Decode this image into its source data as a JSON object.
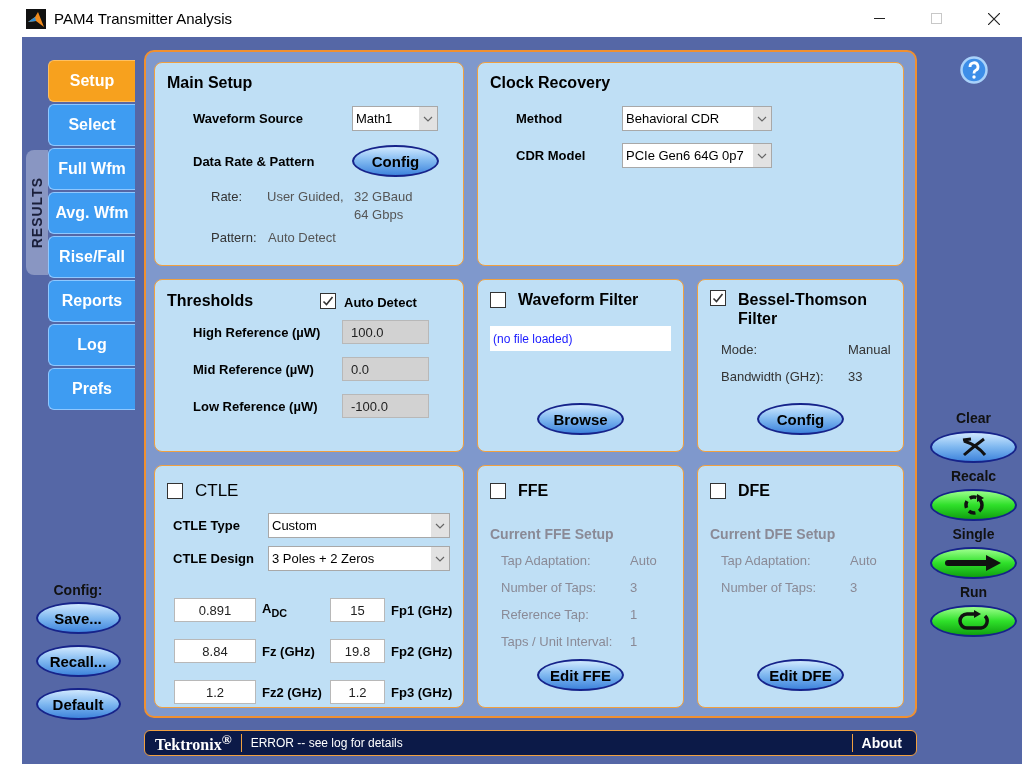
{
  "window": {
    "title": "PAM4 Transmitter Analysis",
    "maximize_disabled": true
  },
  "tabs": [
    {
      "label": "Setup",
      "selected": true
    },
    {
      "label": "Select",
      "selected": false
    },
    {
      "label": "Full Wfm",
      "selected": false
    },
    {
      "label": "Avg. Wfm",
      "selected": false
    },
    {
      "label": "Rise/Fall",
      "selected": false
    },
    {
      "label": "Reports",
      "selected": false
    },
    {
      "label": "Log",
      "selected": false
    },
    {
      "label": "Prefs",
      "selected": false
    }
  ],
  "results_label": "RESULTS",
  "config": {
    "label": "Config:",
    "buttons": [
      "Save...",
      "Recall...",
      "Default"
    ]
  },
  "main_setup": {
    "title": "Main Setup",
    "waveform_source": {
      "label": "Waveform Source",
      "value": "Math1"
    },
    "data_rate": {
      "label": "Data Rate & Pattern",
      "button": "Config"
    },
    "rate": {
      "label": "Rate:",
      "value": "User Guided,",
      "lines": [
        "32 GBaud",
        "64 Gbps"
      ]
    },
    "pattern": {
      "label": "Pattern:",
      "value": "Auto Detect"
    }
  },
  "clock_recovery": {
    "title": "Clock Recovery",
    "fields": [
      {
        "label": "Method",
        "value": "Behavioral CDR"
      },
      {
        "label": "CDR Model",
        "value": "PCIe Gen6 64G 0p7"
      }
    ]
  },
  "thresholds": {
    "title": "Thresholds",
    "auto_detect": {
      "label": "Auto Detect",
      "checked": true
    },
    "fields": [
      {
        "label": "High Reference (µW)",
        "value": "100.0",
        "disabled": true
      },
      {
        "label": "Mid Reference (µW)",
        "value": "0.0",
        "disabled": true
      },
      {
        "label": "Low Reference (µW)",
        "value": "-100.0",
        "disabled": true
      }
    ]
  },
  "waveform_filter": {
    "title": "Waveform Filter",
    "checked": false,
    "file": "(no file loaded)",
    "button": "Browse"
  },
  "bessel_thomson": {
    "title": "Bessel-Thomson Filter",
    "checked": true,
    "rows": [
      {
        "label": "Mode:",
        "value": "Manual"
      },
      {
        "label": "Bandwidth (GHz):",
        "value": "33"
      }
    ],
    "button": "Config"
  },
  "ctle": {
    "title": "CTLE",
    "checked": false,
    "selects": [
      {
        "label": "CTLE Type",
        "value": "Custom"
      },
      {
        "label": "CTLE Design",
        "value": "3 Poles + 2 Zeros"
      }
    ],
    "params": [
      {
        "value": "0.891",
        "label": "A$_{DC}$"
      },
      {
        "value": "15",
        "label": "Fp1 (GHz)"
      },
      {
        "value": "8.84",
        "label": "Fz (GHz)"
      },
      {
        "value": "19.8",
        "label": "Fp2 (GHz)"
      },
      {
        "value": "1.2",
        "label": "Fz2 (GHz)"
      },
      {
        "value": "1.2",
        "label": "Fp3 (GHz)"
      }
    ]
  },
  "ffe": {
    "title": "FFE",
    "checked": false,
    "disabled": true,
    "setup_title": "Current FFE Setup",
    "rows": [
      {
        "label": "Tap Adaptation:",
        "value": "Auto"
      },
      {
        "label": "Number of Taps:",
        "value": "3"
      },
      {
        "label": "Reference Tap:",
        "value": "1"
      },
      {
        "label": "Taps / Unit Interval:",
        "value": "1"
      }
    ],
    "button": "Edit FFE"
  },
  "dfe": {
    "title": "DFE",
    "checked": false,
    "disabled": true,
    "setup_title": "Current DFE Setup",
    "rows": [
      {
        "label": "Tap Adaptation:",
        "value": "Auto"
      },
      {
        "label": "Number of Taps:",
        "value": "3"
      }
    ],
    "button": "Edit DFE"
  },
  "actions": [
    {
      "kind": "clear",
      "label": "Clear"
    },
    {
      "kind": "recalc",
      "label": "Recalc"
    },
    {
      "kind": "single",
      "label": "Single"
    },
    {
      "kind": "run",
      "label": "Run"
    }
  ],
  "status_bar": {
    "brand": "Tektronix$^{®}$",
    "message": "ERROR -- see log for details",
    "about": "About"
  }
}
